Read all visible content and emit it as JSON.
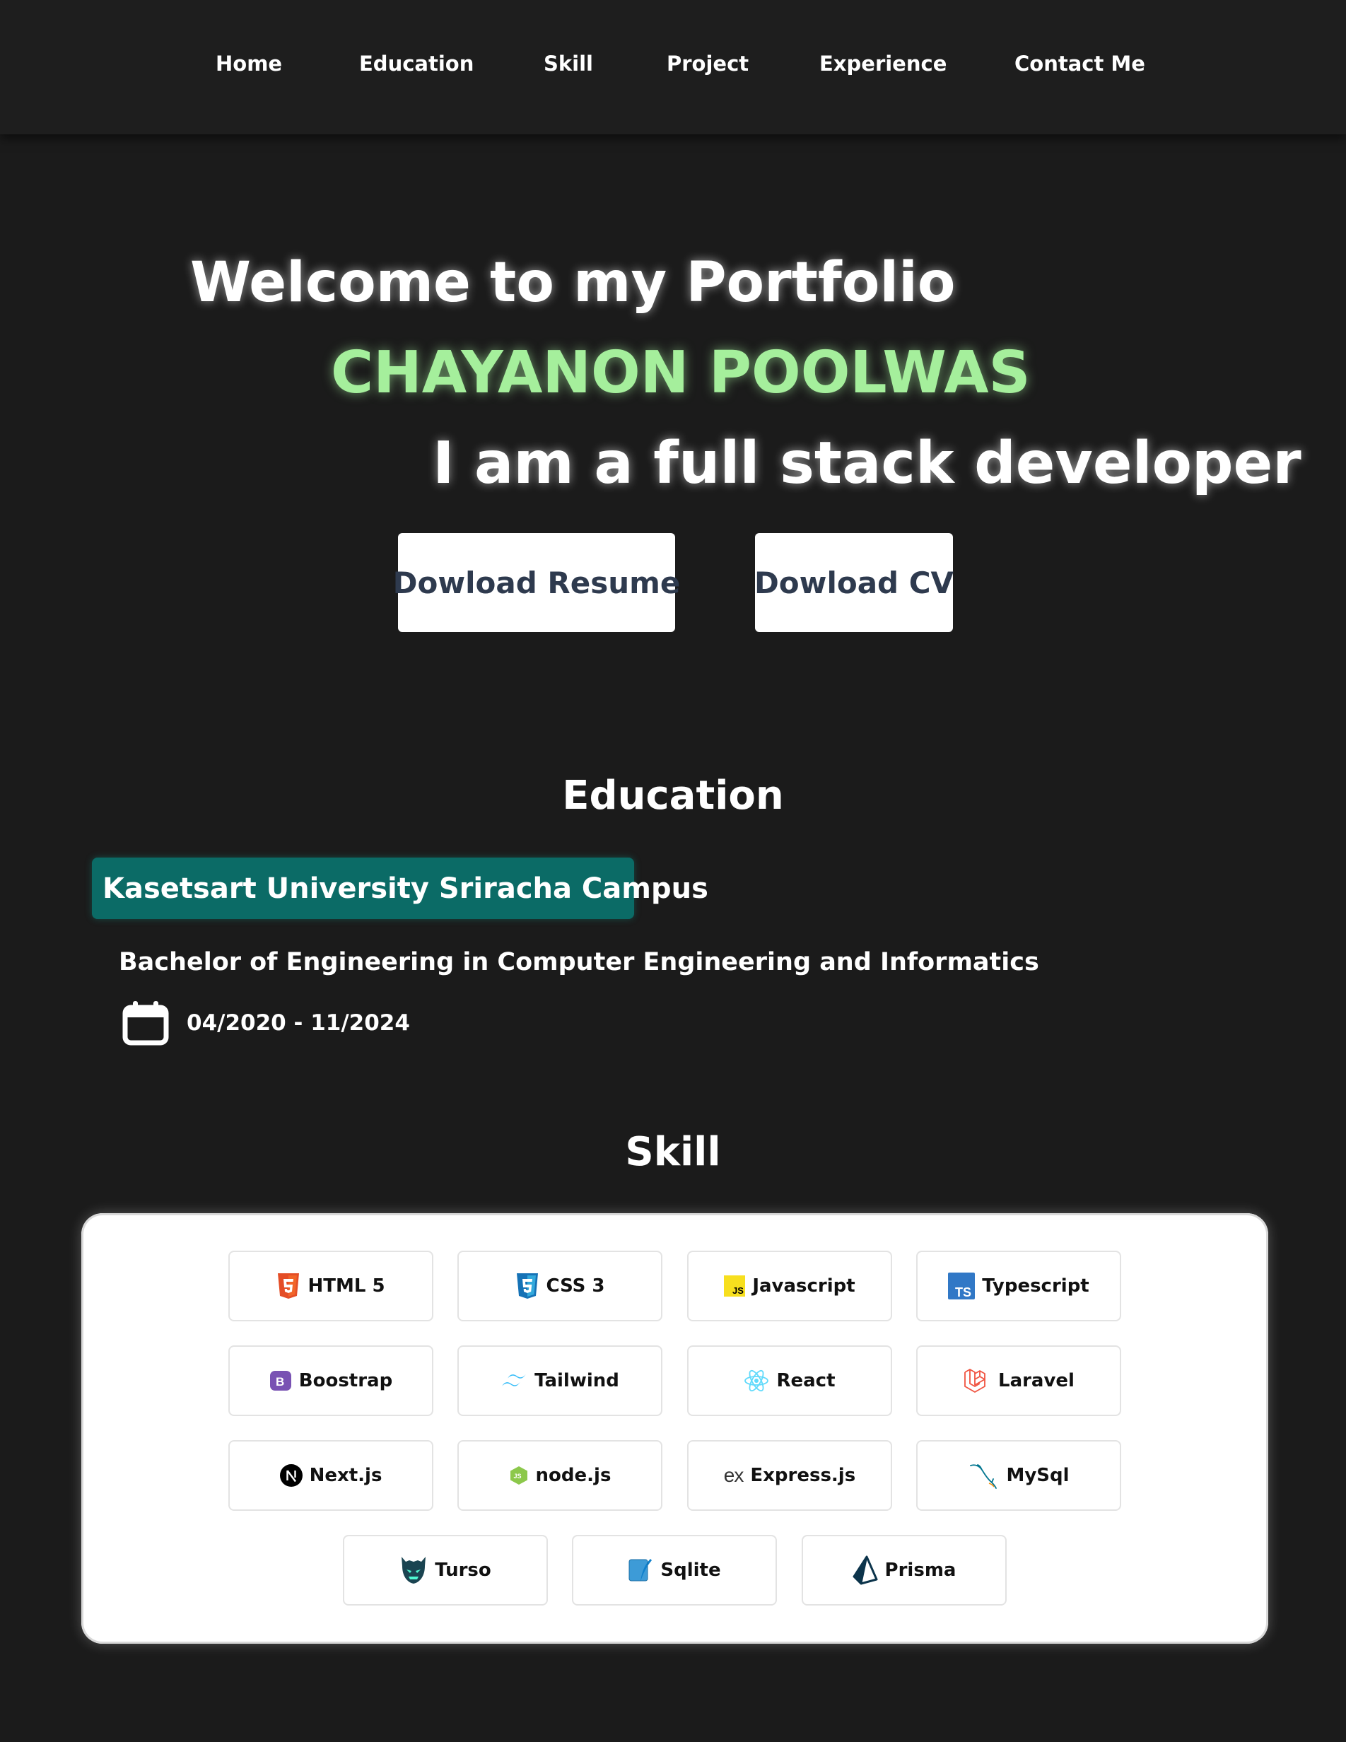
{
  "nav": {
    "items": [
      {
        "label": "Home"
      },
      {
        "label": "Education"
      },
      {
        "label": "Skill"
      },
      {
        "label": "Project"
      },
      {
        "label": "Experience"
      },
      {
        "label": "Contact Me"
      }
    ]
  },
  "hero": {
    "welcome": "Welcome to my Portfolio",
    "name": "CHAYANON POOLWAS",
    "role": "I am a full stack developer",
    "resume_button": "Dowload Resume",
    "cv_button": "Dowload CV",
    "name_color": "#a5ef9c"
  },
  "education": {
    "title": "Education",
    "university": "Kasetsart University Sriracha Campus",
    "degree": "Bachelor of Engineering in Computer Engineering and Informatics",
    "dates": "04/2020 - 11/2024",
    "date_icon": "calendar-icon",
    "badge_color": "#0b6b66"
  },
  "skills": {
    "title": "Skill",
    "items": [
      {
        "label": "HTML 5",
        "icon": "html5-icon"
      },
      {
        "label": "CSS 3",
        "icon": "css3-icon"
      },
      {
        "label": "Javascript",
        "icon": "javascript-icon"
      },
      {
        "label": "Typescript",
        "icon": "typescript-icon"
      },
      {
        "label": "Boostrap",
        "icon": "bootstrap-icon"
      },
      {
        "label": "Tailwind",
        "icon": "tailwind-icon"
      },
      {
        "label": "React",
        "icon": "react-icon"
      },
      {
        "label": "Laravel",
        "icon": "laravel-icon"
      },
      {
        "label": "Next.js",
        "icon": "nextjs-icon"
      },
      {
        "label": "node.js",
        "icon": "nodejs-icon"
      },
      {
        "label": "Express.js",
        "icon": "express-icon"
      },
      {
        "label": "MySql",
        "icon": "mysql-icon"
      },
      {
        "label": "Turso",
        "icon": "turso-icon"
      },
      {
        "label": "Sqlite",
        "icon": "sqlite-icon"
      },
      {
        "label": "Prisma",
        "icon": "prisma-icon"
      }
    ]
  }
}
